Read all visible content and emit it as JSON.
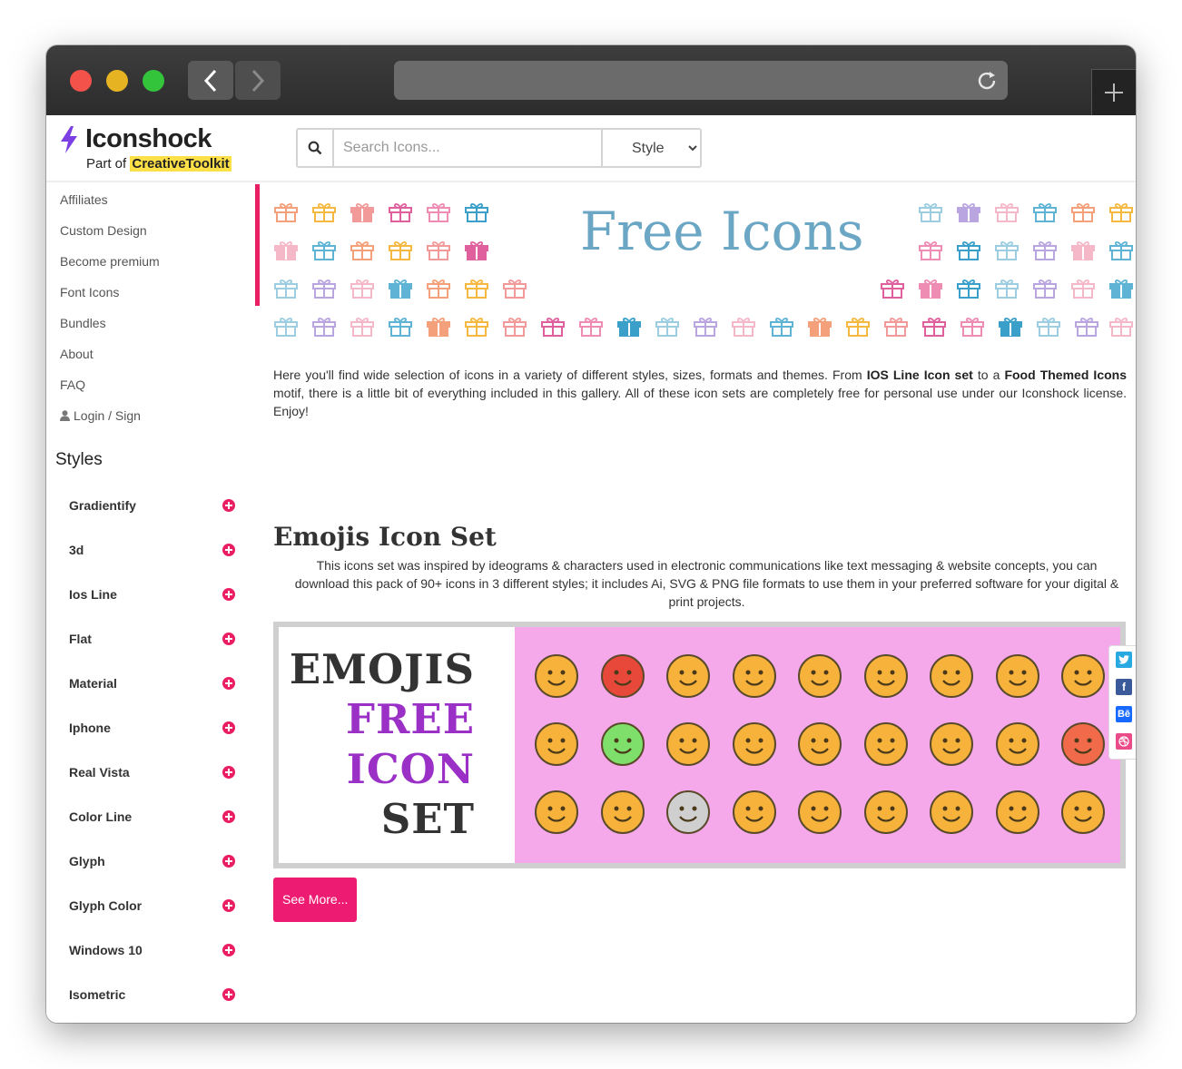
{
  "brand": {
    "name": "Iconshock",
    "sub_prefix": "Part of ",
    "sub_highlight": "CreativeToolkit"
  },
  "search": {
    "placeholder": "Search Icons...",
    "style_label": "Style"
  },
  "nav": [
    {
      "label": "Affiliates"
    },
    {
      "label": "Custom Design"
    },
    {
      "label": "Become premium"
    },
    {
      "label": "Font Icons"
    },
    {
      "label": "Bundles"
    },
    {
      "label": "About"
    },
    {
      "label": "FAQ"
    },
    {
      "label": "Login / Sign"
    }
  ],
  "styles": {
    "title": "Styles",
    "items": [
      {
        "label": "Gradientify"
      },
      {
        "label": "3d"
      },
      {
        "label": "Ios Line"
      },
      {
        "label": "Flat"
      },
      {
        "label": "Material"
      },
      {
        "label": "Iphone"
      },
      {
        "label": "Real Vista"
      },
      {
        "label": "Color Line"
      },
      {
        "label": "Glyph"
      },
      {
        "label": "Glyph Color"
      },
      {
        "label": "Windows 10"
      },
      {
        "label": "Isometric"
      }
    ]
  },
  "banner": {
    "title": "Free Icons"
  },
  "intro": {
    "p1": "Here you'll find wide selection of icons in a variety of different styles, sizes, formats and themes. From ",
    "link1": "IOS Line Icon set",
    "p2": " to a ",
    "link2": "Food Themed Icons",
    "p3": " motif, there is a little bit of everything included in this gallery. All of these icon sets are completely free for personal use under our Iconshock license. Enjoy!"
  },
  "set": {
    "title": "Emojis Icon Set",
    "description": "This icons set was inspired by ideograms & characters used in electronic communications like text messaging & website concepts, you can download this pack of 90+ icons in 3 different styles; it includes Ai, SVG & PNG file formats to use them in your preferred software for your digital & print projects.",
    "preview_lines": [
      "EMOJIS",
      "FREE",
      "ICON",
      "SET"
    ],
    "see_more": "See More..."
  },
  "colors": {
    "accent": "#e91e63",
    "banner_title": "#6ba6c4",
    "preview_bg": "#f5a8ea",
    "preview_purple": "#9b30c7"
  },
  "share": [
    "twitter-icon",
    "facebook-icon",
    "behance-icon",
    "dribbble-icon"
  ]
}
